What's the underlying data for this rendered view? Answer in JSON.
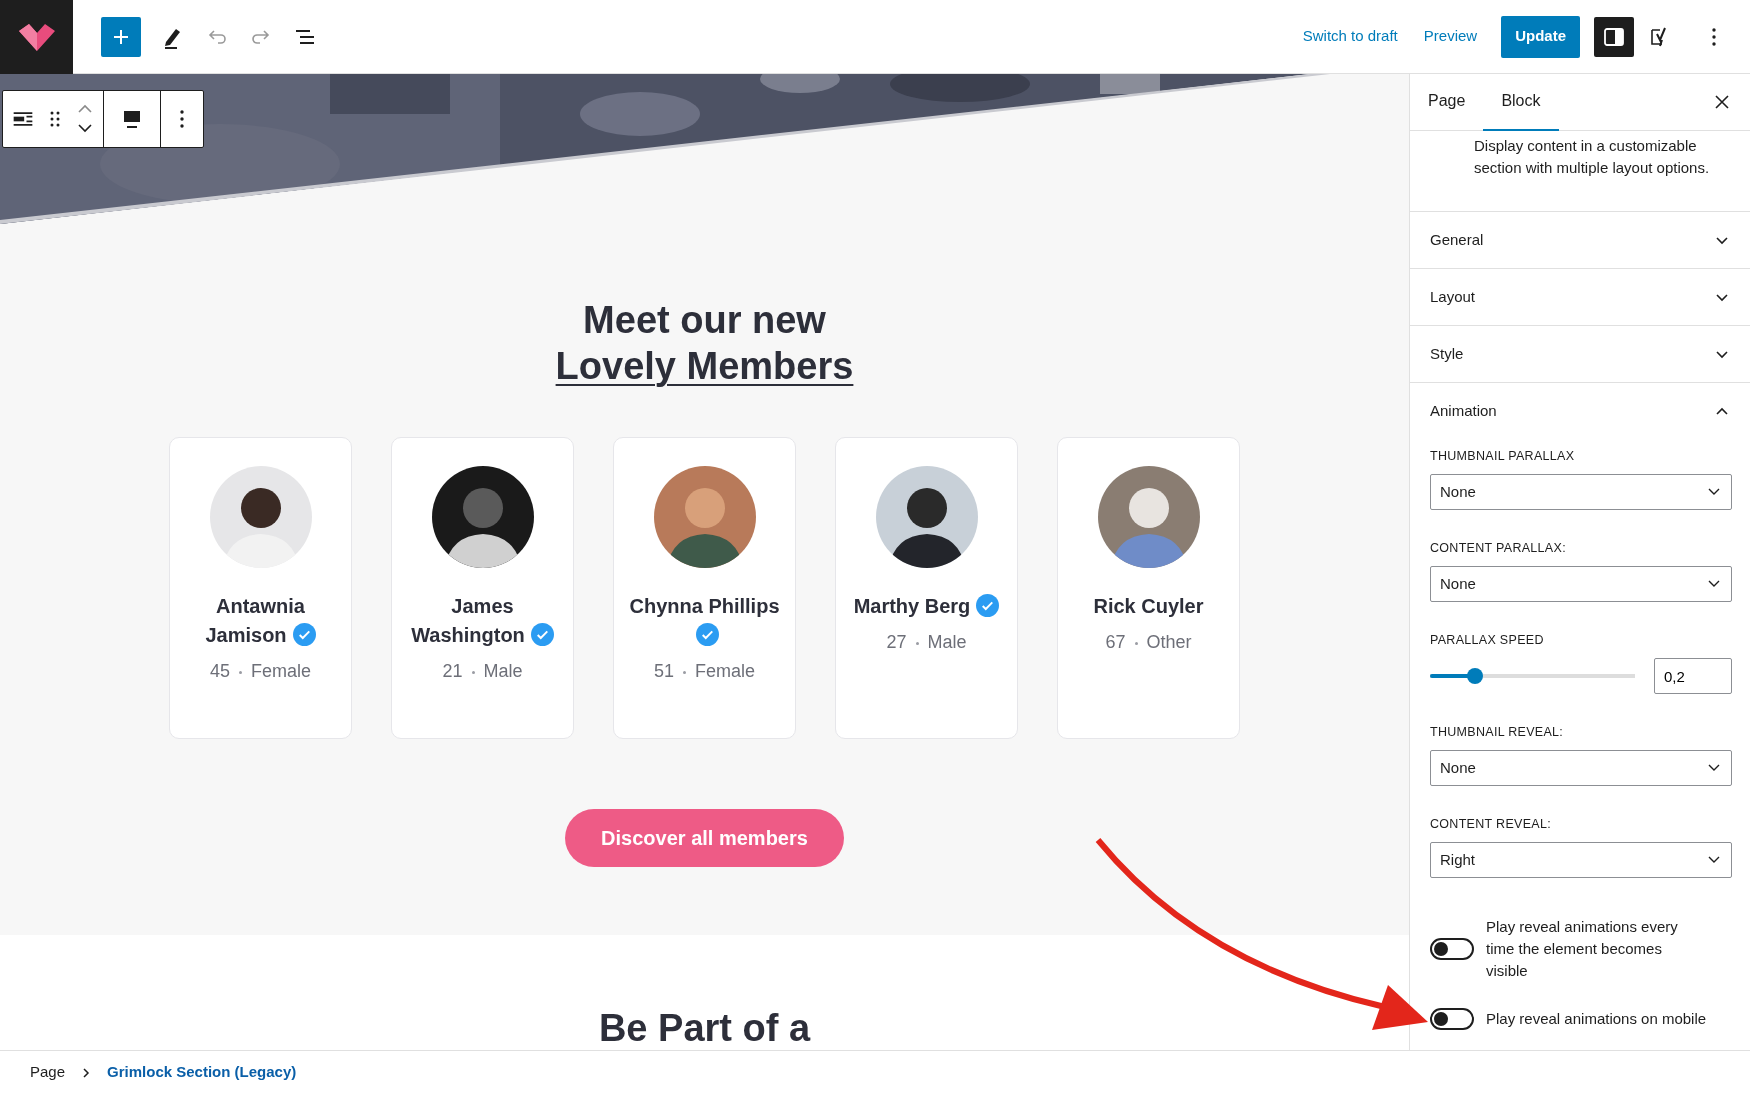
{
  "topbar": {
    "links": [
      "Switch to draft",
      "Preview"
    ],
    "update": "Update",
    "settings_pressed": true
  },
  "canvas": {
    "heading": [
      "Meet our new",
      "Lovely Members"
    ],
    "members": [
      {
        "name": "Antawnia Jamison",
        "verified": true,
        "age": "45",
        "gender": "Female"
      },
      {
        "name": "James Washington",
        "verified": true,
        "age": "21",
        "gender": "Male"
      },
      {
        "name": "Chynna Phillips",
        "verified": true,
        "age": "51",
        "gender": "Female"
      },
      {
        "name": "Marthy Berg",
        "verified": true,
        "age": "27",
        "gender": "Male"
      },
      {
        "name": "Rick Cuyler",
        "verified": false,
        "age": "67",
        "gender": "Other"
      }
    ],
    "button": "Discover all members",
    "next_heading": "Be Part of a"
  },
  "sidebar": {
    "tabs": [
      {
        "label": "Page",
        "selected": false
      },
      {
        "label": "Block",
        "selected": true
      }
    ],
    "description": "Display content in a customizable section with multiple layout options.",
    "panels": [
      {
        "title": "General",
        "expanded": false
      },
      {
        "title": "Layout",
        "expanded": false
      },
      {
        "title": "Style",
        "expanded": false
      },
      {
        "title": "Animation",
        "expanded": true
      }
    ],
    "fields": [
      {
        "kind": "select",
        "label": "THUMBNAIL PARALLAX",
        "value": "None"
      },
      {
        "kind": "select",
        "label": "CONTENT PARALLAX:",
        "value": "None"
      },
      {
        "kind": "range",
        "label": "PARALLAX SPEED",
        "level": 0.22,
        "value": "0,2"
      },
      {
        "kind": "select",
        "label": "THUMBNAIL REVEAL:",
        "value": "None"
      },
      {
        "kind": "select",
        "label": "CONTENT REVEAL:",
        "value": "Right"
      },
      {
        "kind": "toggle",
        "label": "Play reveal animations every time the element becomes visible",
        "on": false
      },
      {
        "kind": "toggle",
        "label": "Play reveal animations on mobile",
        "on": false
      }
    ]
  },
  "breadcrumb": [
    "Page",
    "Grimlock Section (Legacy)"
  ]
}
